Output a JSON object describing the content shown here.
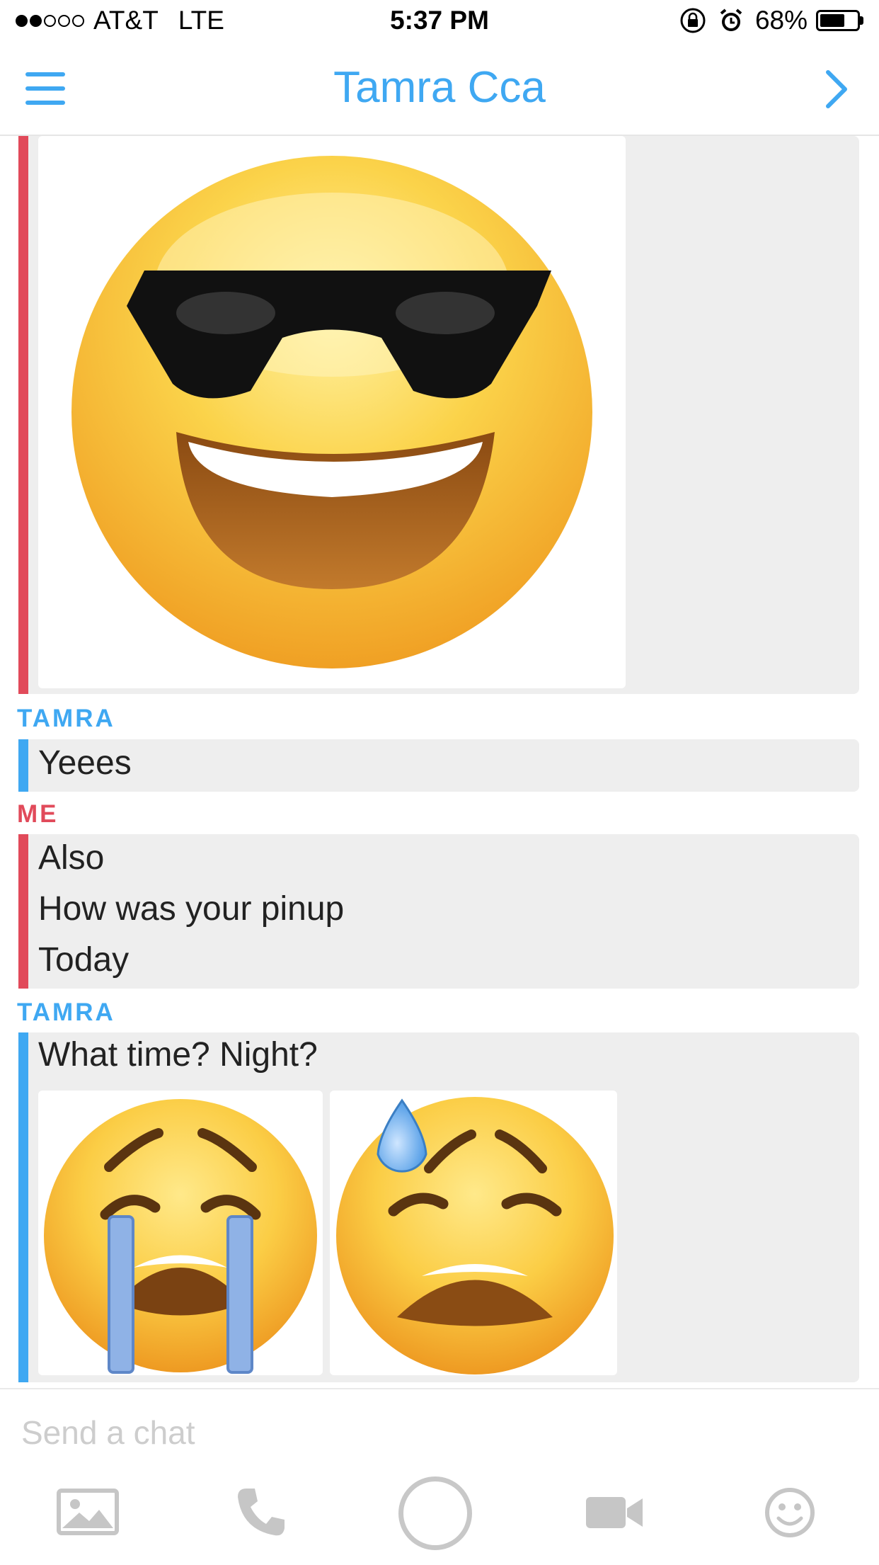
{
  "status_bar": {
    "carrier": "AT&T",
    "network": "LTE",
    "time": "5:37 PM",
    "battery": "68%",
    "battery_level": 0.68,
    "signal_bars": 2
  },
  "header": {
    "title": "Tamra Cca",
    "left_icon": "menu-icon",
    "right_icon": "chevron-right-icon"
  },
  "colors": {
    "accent_blue": "#3fa8f2",
    "accent_red": "#e14a5a",
    "bubble_bg": "#eeeeee"
  },
  "messages": [
    {
      "sender": "",
      "type": "image",
      "emoji": "smiling-face-with-sunglasses"
    },
    {
      "sender": "TAMRA",
      "lines": [
        "Yeees"
      ]
    },
    {
      "sender": "ME",
      "lines": [
        "Also",
        "How was your pinup",
        "Today"
      ]
    },
    {
      "sender": "TAMRA",
      "lines": [
        "What time? Night?"
      ],
      "emojis": [
        "loudly-crying-face",
        "weary-face-with-sweat"
      ]
    }
  ],
  "input": {
    "placeholder": "Send a chat"
  },
  "toolbar": [
    "image-icon",
    "phone-icon",
    "capture-button",
    "video-icon",
    "emoji-icon"
  ]
}
